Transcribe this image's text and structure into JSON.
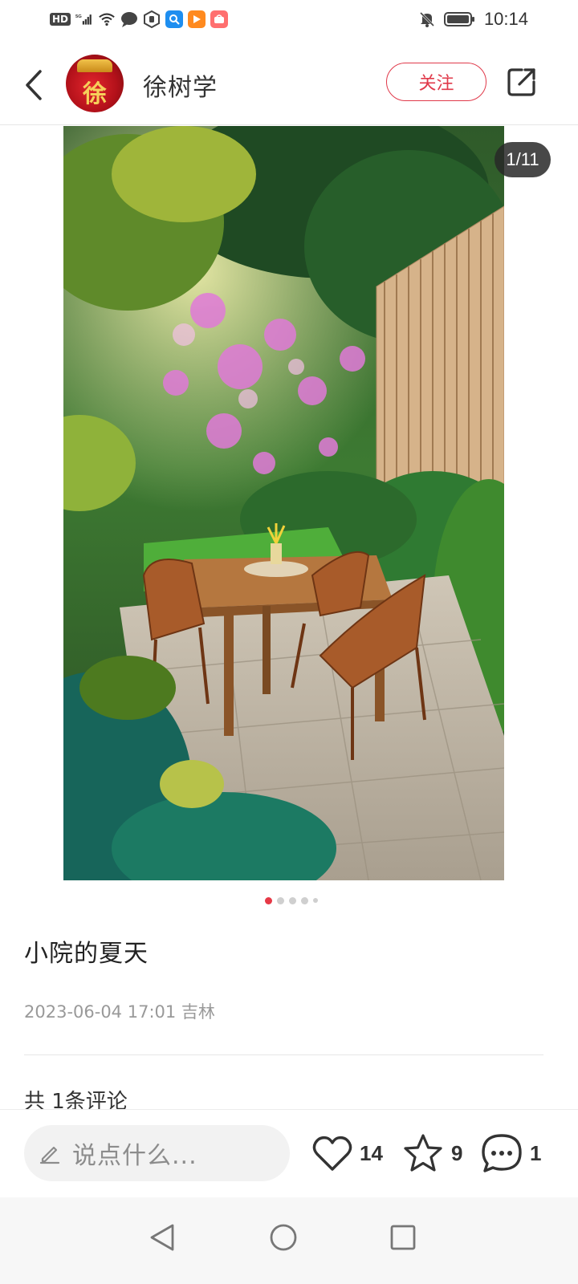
{
  "status_bar": {
    "network_badge": "HD",
    "signal_label": "5G",
    "time": "10:14",
    "icons": [
      "hd-icon",
      "signal-5g-icon",
      "wifi-icon",
      "message-icon",
      "hand-icon",
      "search-app-icon",
      "video-app-icon",
      "shop-app-icon",
      "mute-icon",
      "battery-icon"
    ]
  },
  "header": {
    "avatar_char": "徐",
    "user_name": "徐树学",
    "follow_label": "关注",
    "back_icon": "chevron-left-icon",
    "share_icon": "share-external-icon"
  },
  "photo": {
    "page_counter": "1/11"
  },
  "carousel": {
    "active_index": 0,
    "dot_count": 5
  },
  "post": {
    "title": "小院的夏天",
    "meta": "2023-06-04 17:01 吉林",
    "comment_count": "共 1条评论"
  },
  "action_bar": {
    "input_placeholder": "说点什么...",
    "likes": "14",
    "favorites": "9",
    "comments": "1"
  },
  "colors": {
    "accent": "#e0394a",
    "dot_active": "#e63946",
    "dot_inactive": "#cfcfcf"
  }
}
